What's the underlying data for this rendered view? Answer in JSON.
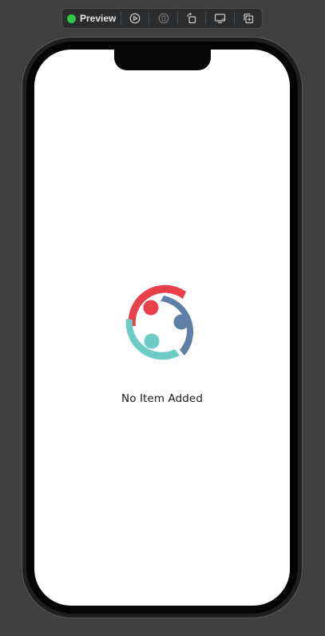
{
  "toolbar": {
    "preview_label": "Preview",
    "status_color": "#33c748",
    "buttons": [
      {
        "icon": "live-play-icon"
      },
      {
        "icon": "selectable-mode-icon"
      },
      {
        "icon": "rotate-device-icon"
      },
      {
        "icon": "device-settings-icon"
      },
      {
        "icon": "duplicate-preview-icon"
      }
    ]
  },
  "app": {
    "logo_icon": "community-people-logo",
    "logo_colors": {
      "red": "#e8404b",
      "blue": "#5f7fa6",
      "teal": "#6ccbc4"
    },
    "empty_message": "No Item Added"
  }
}
